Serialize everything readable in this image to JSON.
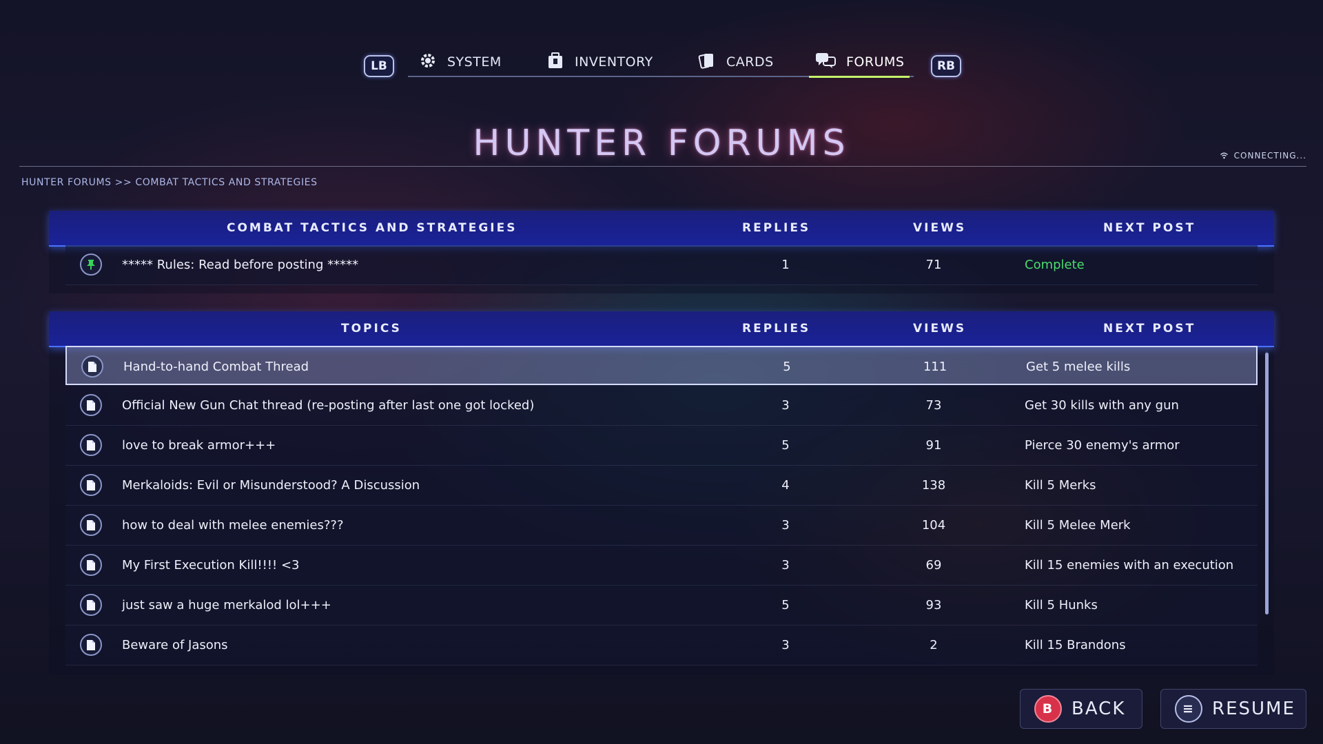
{
  "nav": {
    "left_bumper": "LB",
    "right_bumper": "RB",
    "tabs": [
      {
        "label": "SYSTEM",
        "icon": "gear-icon"
      },
      {
        "label": "INVENTORY",
        "icon": "backpack-icon"
      },
      {
        "label": "CARDS",
        "icon": "cards-icon"
      },
      {
        "label": "FORUMS",
        "icon": "chat-bubbles-icon",
        "active": true
      }
    ]
  },
  "page": {
    "title": "HUNTER FORUMS",
    "connection_status": "CONNECTING...",
    "breadcrumb": "HUNTER FORUMS >> COMBAT TACTICS AND STRATEGIES"
  },
  "pinned_table": {
    "headers": {
      "topic": "COMBAT TACTICS AND STRATEGIES",
      "replies": "REPLIES",
      "views": "VIEWS",
      "next_post": "NEXT POST"
    },
    "rows": [
      {
        "title": "***** Rules: Read before posting *****",
        "replies": "1",
        "views": "71",
        "next_post": "Complete"
      }
    ]
  },
  "topics_table": {
    "headers": {
      "topic": "TOPICS",
      "replies": "REPLIES",
      "views": "VIEWS",
      "next_post": "NEXT POST"
    },
    "rows": [
      {
        "title": "Hand-to-hand Combat Thread",
        "replies": "5",
        "views": "111",
        "next_post": "Get 5 melee kills"
      },
      {
        "title": "Official New Gun Chat thread (re-posting after last one got locked)",
        "replies": "3",
        "views": "73",
        "next_post": "Get 30 kills with any gun"
      },
      {
        "title": "love to break armor+++",
        "replies": "5",
        "views": "91",
        "next_post": "Pierce 30 enemy's armor"
      },
      {
        "title": "Merkaloids: Evil or Misunderstood? A Discussion",
        "replies": "4",
        "views": "138",
        "next_post": "Kill 5 Merks"
      },
      {
        "title": "how to deal with melee enemies???",
        "replies": "3",
        "views": "104",
        "next_post": "Kill 5 Melee Merk"
      },
      {
        "title": "My First Execution Kill!!!! <3",
        "replies": "3",
        "views": "69",
        "next_post": "Kill 15 enemies with an execution"
      },
      {
        "title": "just saw a huge merkalod lol+++",
        "replies": "5",
        "views": "93",
        "next_post": "Kill 5 Hunks"
      },
      {
        "title": "Beware of Jasons",
        "replies": "3",
        "views": "2",
        "next_post": "Kill 15 Brandons"
      }
    ]
  },
  "footer": {
    "back": {
      "glyph": "B",
      "label": "BACK"
    },
    "resume": {
      "glyph": "≡",
      "label": "RESUME"
    }
  },
  "colors": {
    "accent": "#4b73ff",
    "header_bar": "#1a1f8a",
    "active_tab": "#c4f56a",
    "complete": "#4cdc6c",
    "pin": "#39d45a"
  }
}
